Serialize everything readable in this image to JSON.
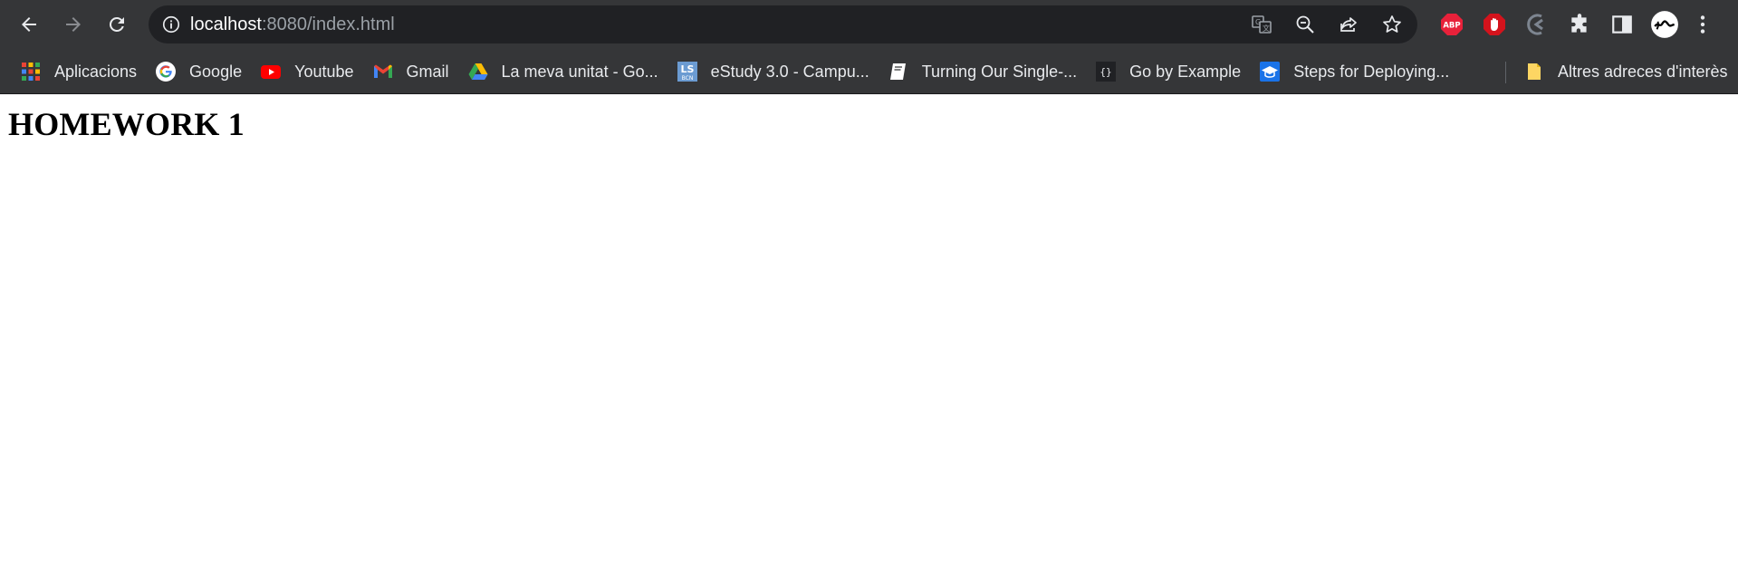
{
  "browser": {
    "url_host": "localhost",
    "url_rest": ":8080/index.html",
    "nav": {
      "back_icon": "arrow-left-icon",
      "forward_icon": "arrow-right-icon",
      "reload_icon": "reload-icon"
    },
    "omnibox_icons": [
      "translate-icon",
      "zoom-out-icon",
      "share-icon",
      "star-icon"
    ],
    "extensions": [
      "adblock-plus-icon",
      "stop-hand-icon",
      "arrow-extension-icon",
      "puzzle-icon",
      "side-panel-icon",
      "profile-avatar",
      "kebab-menu-icon"
    ]
  },
  "bookmarks": [
    {
      "label": "Aplicacions",
      "icon": "apps-grid-icon"
    },
    {
      "label": "Google",
      "icon": "google-icon"
    },
    {
      "label": "Youtube",
      "icon": "youtube-icon"
    },
    {
      "label": "Gmail",
      "icon": "gmail-icon"
    },
    {
      "label": "La meva unitat - Go...",
      "icon": "google-drive-icon"
    },
    {
      "label": "eStudy 3.0 - Campu...",
      "icon": "lsbcn-icon"
    },
    {
      "label": "Turning Our Single-...",
      "icon": "book-icon"
    },
    {
      "label": "Go by Example",
      "icon": "braces-icon"
    },
    {
      "label": "Steps for Deploying...",
      "icon": "graduation-cap-icon"
    }
  ],
  "other_bookmarks": {
    "label": "Altres adreces d'interès",
    "icon": "folder-icon"
  },
  "page": {
    "heading": "HOMEWORK 1"
  },
  "colors": {
    "chrome_bg": "#353638",
    "omnibox_bg": "#202124",
    "text_light": "#e8eaed",
    "url_muted": "#9aa0a6"
  }
}
